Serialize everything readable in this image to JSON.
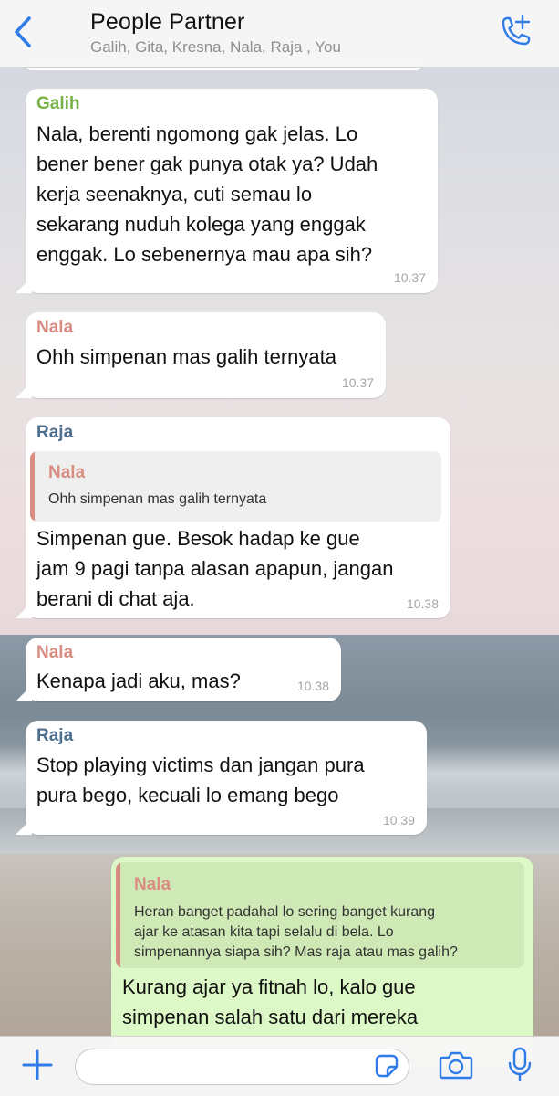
{
  "header": {
    "title": "People Partner",
    "subtitle": "Galih, Gita, Kresna, Nala, Raja , You",
    "back_icon": "chevron-left-icon",
    "call_icon": "phone-plus-icon"
  },
  "colors": {
    "accent": "#2f7ce8",
    "sender_galih": "#77b248",
    "sender_nala": "#d98c82",
    "sender_raja": "#4f6f8f",
    "outgoing_bubble": "#dcf8c6"
  },
  "messages": [
    {
      "sender": "Galih",
      "lines": [
        "Nala, berenti ngomong gak jelas. Lo",
        "bener bener gak punya otak ya? Udah",
        "kerja seenaknya, cuti semau lo",
        "sekarang nuduh kolega yang enggak",
        "enggak. Lo sebenernya mau apa sih?"
      ],
      "time": "10.37"
    },
    {
      "sender": "Nala",
      "lines": [
        "Ohh simpenan mas galih ternyata"
      ],
      "time": "10.37"
    },
    {
      "sender": "Raja",
      "quote": {
        "sender": "Nala",
        "lines": [
          "Ohh simpenan mas galih ternyata"
        ]
      },
      "lines": [
        "Simpenan gue. Besok hadap ke gue",
        "jam 9 pagi tanpa alasan apapun, jangan",
        "berani di chat aja."
      ],
      "time": "10.38"
    },
    {
      "sender": "Nala",
      "lines": [
        "Kenapa jadi aku, mas?"
      ],
      "time": "10.38"
    },
    {
      "sender": "Raja",
      "lines": [
        "Stop playing victims dan jangan pura",
        "pura bego, kecuali lo emang bego"
      ],
      "time": "10.39"
    },
    {
      "outgoing": true,
      "quote": {
        "sender": "Nala",
        "lines": [
          "Heran banget padahal lo sering banget kurang",
          "ajar ke atasan kita tapi selalu di bela. Lo",
          "simpenannya siapa sih? Mas raja atau mas galih?"
        ]
      },
      "lines": [
        "Kurang ajar ya fitnah lo, kalo gue",
        "simpenan salah satu dari mereka"
      ]
    }
  ],
  "composer": {
    "plus_icon": "plus-icon",
    "sticker_icon": "sticker-icon",
    "camera_icon": "camera-icon",
    "mic_icon": "microphone-icon"
  }
}
